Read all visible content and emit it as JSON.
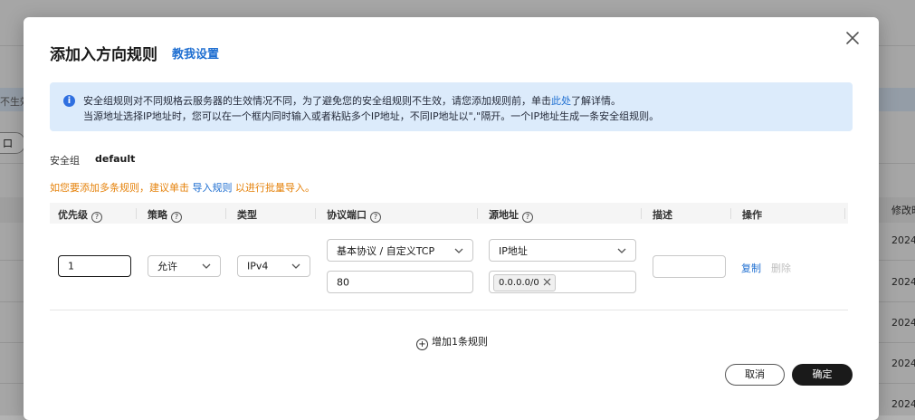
{
  "background": {
    "warning_fragment": "不生效",
    "button_fragment": "口",
    "column_header": "修改时",
    "row_values": [
      "2024",
      "2024",
      "2024",
      "2024",
      "2024"
    ]
  },
  "dialog": {
    "title": "添加入方向规则",
    "tutorial_link": "教我设置",
    "notice": {
      "line1_before": "安全组规则对不同规格云服务器的生效情况不同，为了避免您的安全组规则不生效，请您添加规则前，单击",
      "line1_link": "此处",
      "line1_after": "了解详情。",
      "line2": "当源地址选择IP地址时，您可以在一个框内同时输入或者粘贴多个IP地址，不同IP地址以\",\"隔开。一个IP地址生成一条安全组规则。"
    },
    "security_group": {
      "label": "安全组",
      "value": "default"
    },
    "hint": {
      "before": "如您要添加多条规则，建议单击 ",
      "link": "导入规则",
      "after": " 以进行批量导入。"
    },
    "table": {
      "headers": {
        "priority": "优先级",
        "policy": "策略",
        "type": "类型",
        "protocol_port": "协议端口",
        "source": "源地址",
        "description": "描述",
        "action": "操作"
      },
      "row": {
        "priority": "1",
        "policy": "允许",
        "type": "IPv4",
        "protocol": "基本协议 / 自定义TCP",
        "port": "80",
        "source_type": "IP地址",
        "source_ip": "0.0.0.0/0",
        "description": "",
        "copy_label": "复制",
        "delete_label": "删除"
      }
    },
    "add_rule_label": "增加1条规则",
    "cancel_label": "取消",
    "confirm_label": "确定"
  },
  "colors": {
    "accent_link": "#1f6fd1",
    "hint_orange": "#e5820b",
    "notice_bg": "#dcebfb",
    "primary_button": "#1a1a1a"
  },
  "icons": [
    "close-icon",
    "info-icon",
    "help-icon",
    "chevron-down-icon",
    "clear-tag-icon",
    "plus-circle-icon"
  ]
}
